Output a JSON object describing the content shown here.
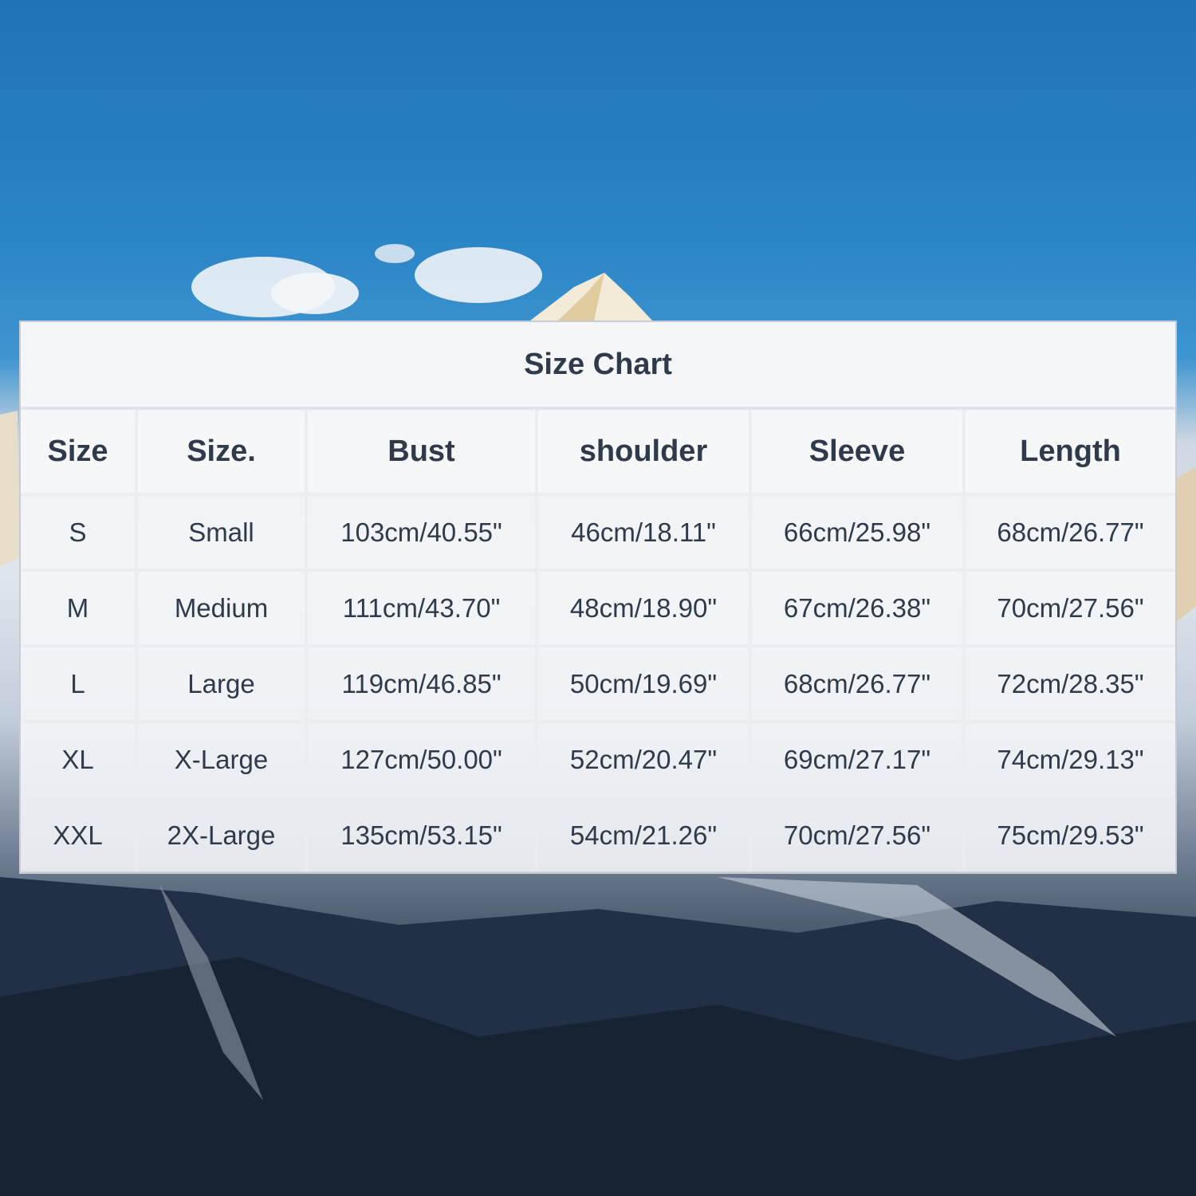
{
  "title": "Size Chart",
  "headers": [
    "Size",
    "Size.",
    "Bust",
    "shoulder",
    "Sleeve",
    "Length"
  ],
  "rows": [
    [
      "S",
      "Small",
      "103cm/40.55\"",
      "46cm/18.11\"",
      "66cm/25.98\"",
      "68cm/26.77\""
    ],
    [
      "M",
      "Medium",
      "111cm/43.70\"",
      "48cm/18.90\"",
      "67cm/26.38\"",
      "70cm/27.56\""
    ],
    [
      "L",
      "Large",
      "119cm/46.85\"",
      "50cm/19.69\"",
      "68cm/26.77\"",
      "72cm/28.35\""
    ],
    [
      "XL",
      "X-Large",
      "127cm/50.00\"",
      "52cm/20.47\"",
      "69cm/27.17\"",
      "74cm/29.13\""
    ],
    [
      "XXL",
      "2X-Large",
      "135cm/53.15\"",
      "54cm/21.26\"",
      "70cm/27.56\"",
      "75cm/29.53\""
    ]
  ],
  "colors": {
    "sky": "#2a85c6",
    "text": "#2f3b4a"
  }
}
